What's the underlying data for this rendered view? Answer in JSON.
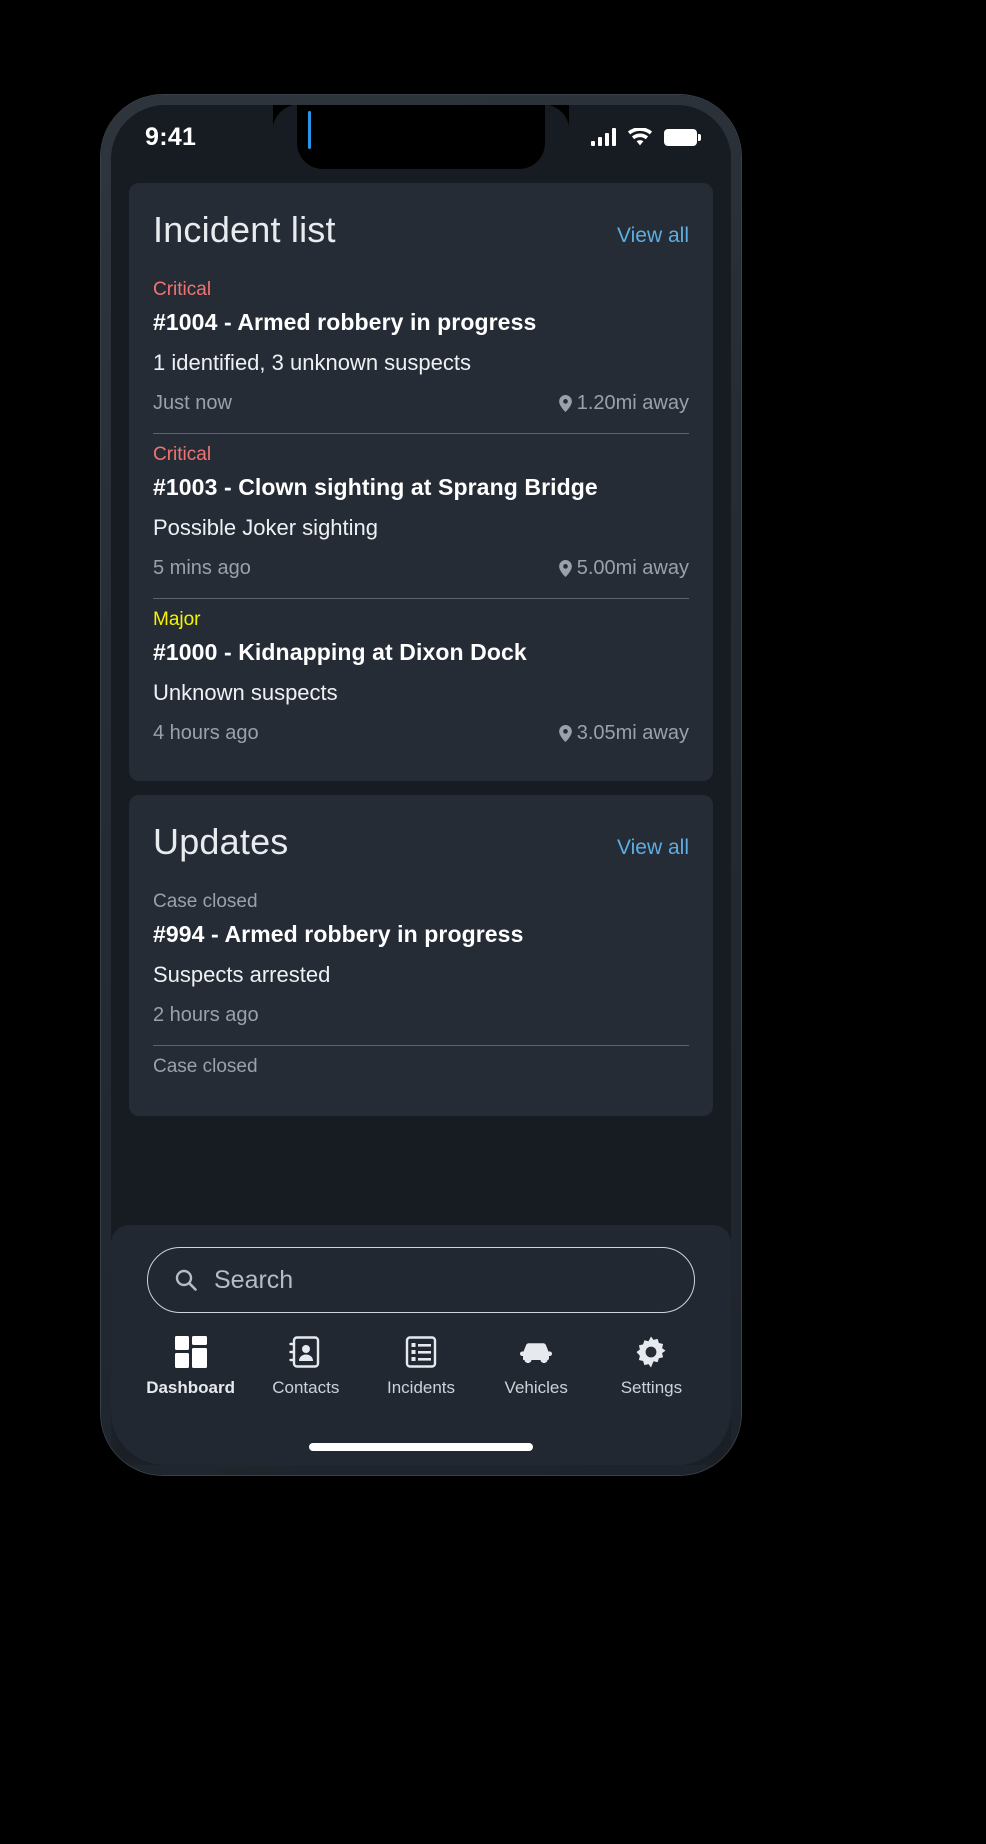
{
  "status_bar": {
    "time": "9:41",
    "signal_icon": "cellular-bars-icon",
    "wifi_icon": "wifi-icon",
    "battery_icon": "battery-full-icon"
  },
  "incident_card": {
    "title": "Incident list",
    "view_all_label": "View all",
    "items": [
      {
        "severity": "Critical",
        "severity_level": "critical",
        "title": "#1004 - Armed robbery in progress",
        "description": "1 identified, 3 unknown suspects",
        "time": "Just now",
        "distance": "1.20mi away"
      },
      {
        "severity": "Critical",
        "severity_level": "critical",
        "title": "#1003 - Clown sighting at Sprang Bridge",
        "description": "Possible Joker sighting",
        "time": "5 mins ago",
        "distance": "5.00mi away"
      },
      {
        "severity": "Major",
        "severity_level": "major",
        "title": "#1000 - Kidnapping at Dixon Dock",
        "description": "Unknown suspects",
        "time": "4 hours ago",
        "distance": "3.05mi away"
      }
    ]
  },
  "updates_card": {
    "title": "Updates",
    "view_all_label": "View all",
    "items": [
      {
        "status": "Case closed",
        "title": "#994 - Armed robbery in progress",
        "description": "Suspects arrested",
        "time": "2 hours ago"
      },
      {
        "status": "Case closed",
        "title": "",
        "description": "",
        "time": ""
      }
    ]
  },
  "search": {
    "placeholder": "Search",
    "value": "",
    "icon": "search-icon"
  },
  "tab_bar": {
    "active_index": 0,
    "tabs": [
      {
        "label": "Dashboard",
        "icon": "dashboard-grid-icon"
      },
      {
        "label": "Contacts",
        "icon": "contacts-person-icon"
      },
      {
        "label": "Incidents",
        "icon": "list-icon"
      },
      {
        "label": "Vehicles",
        "icon": "car-icon"
      },
      {
        "label": "Settings",
        "icon": "gear-icon"
      }
    ]
  },
  "colors": {
    "critical": "#f07470",
    "major": "#f5f500",
    "accent_link": "#5dade2",
    "card_bg": "#262c36",
    "screen_bg": "#171c23"
  }
}
